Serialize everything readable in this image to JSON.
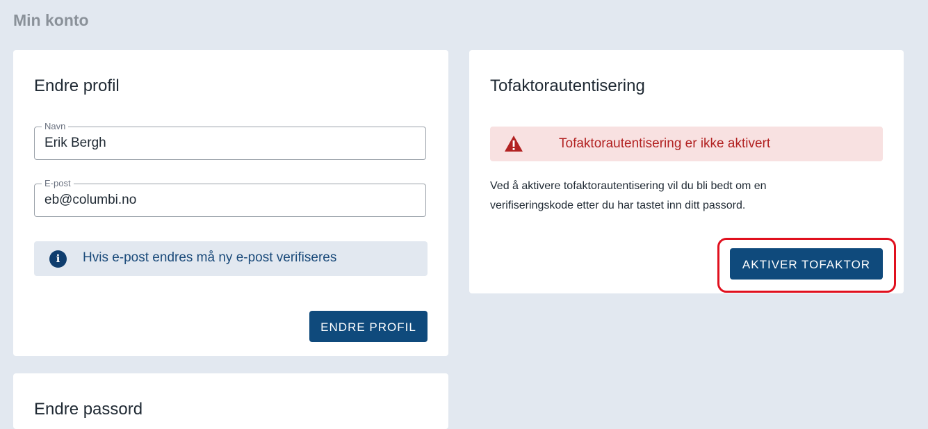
{
  "page": {
    "title": "Min konto"
  },
  "profile": {
    "title": "Endre profil",
    "name_label": "Navn",
    "name_value": "Erik Bergh",
    "email_label": "E-post",
    "email_value": "eb@columbi.no",
    "info_text": "Hvis e-post endres må ny e-post verifiseres",
    "button_label": "ENDRE PROFIL"
  },
  "tfa": {
    "title": "Tofaktorautentisering",
    "alert_text": "Tofaktorautentisering er ikke aktivert",
    "description_line1": "Ved å aktivere tofaktorautentisering vil du bli bedt om en",
    "description_line2": "verifiseringskode etter du har tastet inn ditt passord.",
    "button_label": "AKTIVER TOFAKTOR"
  },
  "password": {
    "title": "Endre passord"
  },
  "icons": {
    "info": "info-icon",
    "warning": "warning-icon"
  },
  "colors": {
    "background": "#e2e8f0",
    "primary_button": "#0f4a7c",
    "alert_bg": "#f8e1e1",
    "alert_text": "#b22222",
    "highlight": "#e0101e"
  }
}
